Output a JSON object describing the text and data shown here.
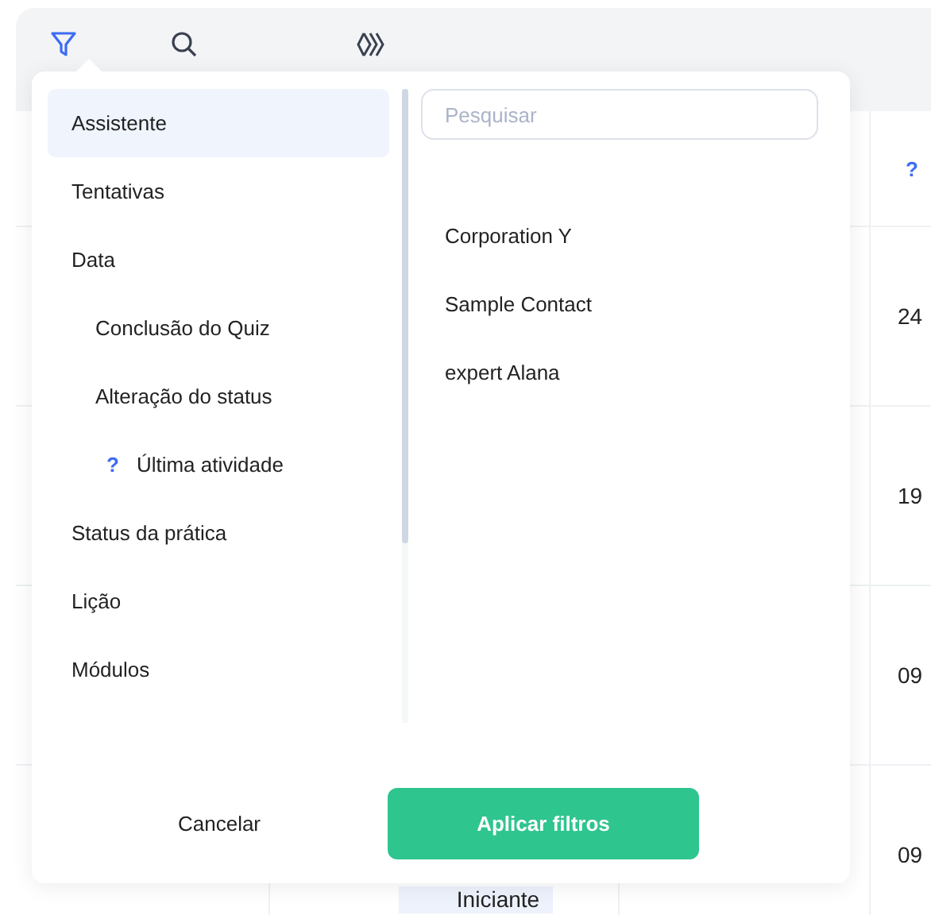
{
  "toolbar": {
    "tools": [
      {
        "kind": "filter",
        "selected": true
      },
      {
        "kind": "search",
        "selected": false
      },
      {
        "kind": "chevrons",
        "selected": false
      }
    ]
  },
  "table": {
    "header": "?",
    "rows": [
      {
        "column_4": "24"
      },
      {
        "column_4": "19"
      },
      {
        "column_4": "09"
      },
      {
        "column_4": "09"
      }
    ],
    "badge": "Iniciante"
  },
  "filter_popup": {
    "categories": [
      {
        "label": "Assistente",
        "selected": true
      },
      {
        "label": "Tentativas",
        "selected": false
      },
      {
        "label": "Data",
        "selected": false,
        "children": [
          {
            "label": "Conclusão do Quiz",
            "selected": false
          },
          {
            "label": "Alteração do status",
            "selected": false
          },
          {
            "label": "Última atividade",
            "marker": "?",
            "selected": false
          }
        ]
      },
      {
        "label": "Status da prática",
        "selected": false
      },
      {
        "label": "Lição",
        "selected": false
      },
      {
        "label": "Módulos",
        "selected": false
      }
    ],
    "search": {
      "placeholder": "Pesquisar"
    },
    "options": [
      "Corporation Y",
      "Sample Contact",
      "expert Alana"
    ],
    "buttons": [
      {
        "label": "Cancelar",
        "kind": "secondary"
      },
      {
        "label": "Aplicar filtros",
        "kind": "primary"
      }
    ]
  }
}
